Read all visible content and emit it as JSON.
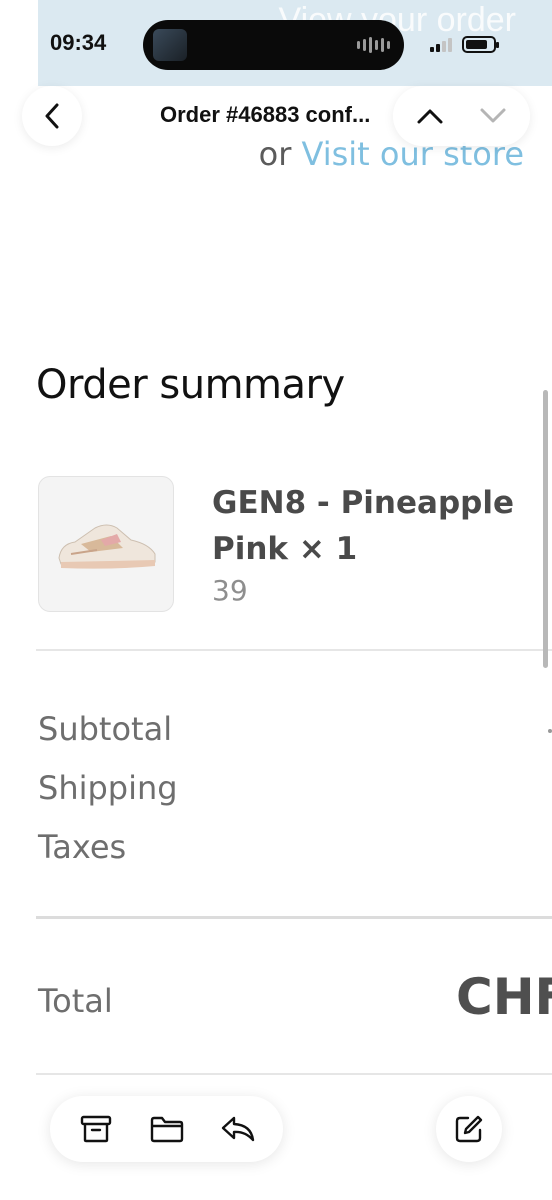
{
  "status_bar": {
    "time": "09:34",
    "signal_bars_active": 2,
    "signal_bars_total": 4,
    "battery_level": 0.8
  },
  "email_content": {
    "banner_text": "View your order",
    "store_prefix": "or",
    "store_link": "Visit our store"
  },
  "nav": {
    "title": "Order #46883 conf...",
    "back_icon": "chevron-left-icon",
    "prev_icon": "chevron-up-icon",
    "next_icon": "chevron-down-icon"
  },
  "order_summary": {
    "heading": "Order summary",
    "item": {
      "name": "GEN8 - Pineapple Pink × 1",
      "variant": "39",
      "image_icon": "sneaker-image"
    },
    "lines": [
      {
        "label": "Subtotal"
      },
      {
        "label": "Shipping"
      },
      {
        "label": "Taxes"
      }
    ],
    "total_label": "Total",
    "total_value": "CHF"
  },
  "toolbar": {
    "archive_icon": "archive-icon",
    "folder_icon": "folder-icon",
    "reply_icon": "reply-icon",
    "compose_icon": "compose-icon"
  },
  "colors": {
    "link": "#7fbfe0",
    "banner": "#dbe9f1",
    "text_primary": "#111111",
    "text_secondary": "#6e6e6e"
  }
}
